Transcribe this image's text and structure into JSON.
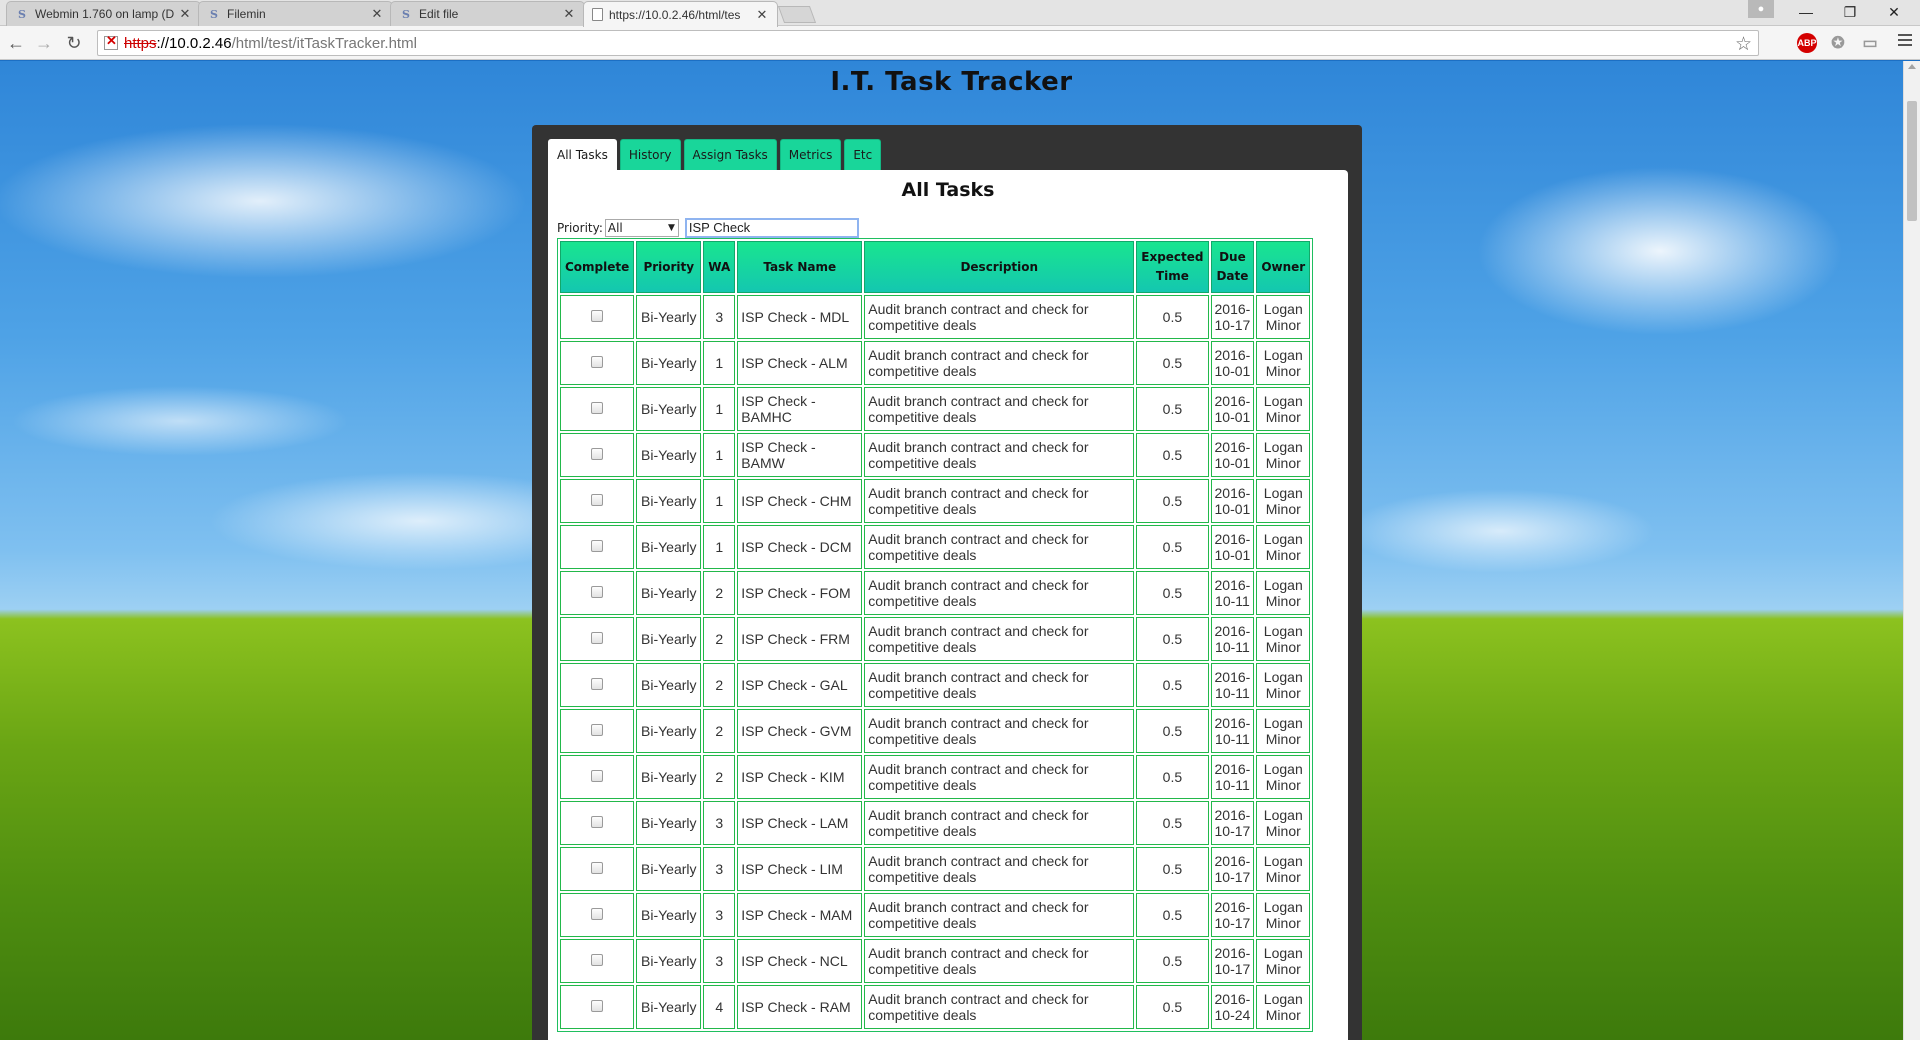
{
  "browser": {
    "tabs": [
      {
        "title": "Webmin 1.760 on lamp (D",
        "icon": "sf-icon"
      },
      {
        "title": "Filemin",
        "icon": "sf-icon"
      },
      {
        "title": "Edit file",
        "icon": "sf-icon"
      },
      {
        "title": "https://10.0.2.46/html/tes",
        "icon": "page-icon"
      }
    ],
    "url": {
      "scheme": "https",
      "rest_host": "://10.0.2.46",
      "path": "/html/test/itTaskTracker.html"
    },
    "extensions": {
      "abp": "ABP"
    }
  },
  "page": {
    "title": "I.T. Task Tracker",
    "tabs": [
      "All Tasks",
      "History",
      "Assign Tasks",
      "Metrics",
      "Etc"
    ],
    "heading": "All Tasks",
    "filter": {
      "label": "Priority:",
      "selected": "All",
      "search_value": "ISP Check"
    },
    "columns": [
      "Complete",
      "Priority",
      "WA",
      "Task Name",
      "Description",
      "Expected Time",
      "Due Date",
      "Owner"
    ],
    "rows": [
      {
        "priority": "Bi-Yearly",
        "wa": "3",
        "task": "ISP Check - MDL",
        "desc": "Audit branch contract and check for competitive deals",
        "time": "0.5",
        "due": "2016-10-17",
        "owner": "Logan Minor"
      },
      {
        "priority": "Bi-Yearly",
        "wa": "1",
        "task": "ISP Check - ALM",
        "desc": "Audit branch contract and check for competitive deals",
        "time": "0.5",
        "due": "2016-10-01",
        "owner": "Logan Minor"
      },
      {
        "priority": "Bi-Yearly",
        "wa": "1",
        "task": "ISP Check - BAMHC",
        "desc": "Audit branch contract and check for competitive deals",
        "time": "0.5",
        "due": "2016-10-01",
        "owner": "Logan Minor"
      },
      {
        "priority": "Bi-Yearly",
        "wa": "1",
        "task": "ISP Check - BAMW",
        "desc": "Audit branch contract and check for competitive deals",
        "time": "0.5",
        "due": "2016-10-01",
        "owner": "Logan Minor"
      },
      {
        "priority": "Bi-Yearly",
        "wa": "1",
        "task": "ISP Check - CHM",
        "desc": "Audit branch contract and check for competitive deals",
        "time": "0.5",
        "due": "2016-10-01",
        "owner": "Logan Minor"
      },
      {
        "priority": "Bi-Yearly",
        "wa": "1",
        "task": "ISP Check - DCM",
        "desc": "Audit branch contract and check for competitive deals",
        "time": "0.5",
        "due": "2016-10-01",
        "owner": "Logan Minor"
      },
      {
        "priority": "Bi-Yearly",
        "wa": "2",
        "task": "ISP Check - FOM",
        "desc": "Audit branch contract and check for competitive deals",
        "time": "0.5",
        "due": "2016-10-11",
        "owner": "Logan Minor"
      },
      {
        "priority": "Bi-Yearly",
        "wa": "2",
        "task": "ISP Check - FRM",
        "desc": "Audit branch contract and check for competitive deals",
        "time": "0.5",
        "due": "2016-10-11",
        "owner": "Logan Minor"
      },
      {
        "priority": "Bi-Yearly",
        "wa": "2",
        "task": "ISP Check - GAL",
        "desc": "Audit branch contract and check for competitive deals",
        "time": "0.5",
        "due": "2016-10-11",
        "owner": "Logan Minor"
      },
      {
        "priority": "Bi-Yearly",
        "wa": "2",
        "task": "ISP Check - GVM",
        "desc": "Audit branch contract and check for competitive deals",
        "time": "0.5",
        "due": "2016-10-11",
        "owner": "Logan Minor"
      },
      {
        "priority": "Bi-Yearly",
        "wa": "2",
        "task": "ISP Check - KIM",
        "desc": "Audit branch contract and check for competitive deals",
        "time": "0.5",
        "due": "2016-10-11",
        "owner": "Logan Minor"
      },
      {
        "priority": "Bi-Yearly",
        "wa": "3",
        "task": "ISP Check - LAM",
        "desc": "Audit branch contract and check for competitive deals",
        "time": "0.5",
        "due": "2016-10-17",
        "owner": "Logan Minor"
      },
      {
        "priority": "Bi-Yearly",
        "wa": "3",
        "task": "ISP Check - LIM",
        "desc": "Audit branch contract and check for competitive deals",
        "time": "0.5",
        "due": "2016-10-17",
        "owner": "Logan Minor"
      },
      {
        "priority": "Bi-Yearly",
        "wa": "3",
        "task": "ISP Check - MAM",
        "desc": "Audit branch contract and check for competitive deals",
        "time": "0.5",
        "due": "2016-10-17",
        "owner": "Logan Minor"
      },
      {
        "priority": "Bi-Yearly",
        "wa": "3",
        "task": "ISP Check - NCL",
        "desc": "Audit branch contract and check for competitive deals",
        "time": "0.5",
        "due": "2016-10-17",
        "owner": "Logan Minor"
      },
      {
        "priority": "Bi-Yearly",
        "wa": "4",
        "task": "ISP Check - RAM",
        "desc": "Audit branch contract and check for competitive deals",
        "time": "0.5",
        "due": "2016-10-24",
        "owner": "Logan Minor"
      }
    ]
  }
}
